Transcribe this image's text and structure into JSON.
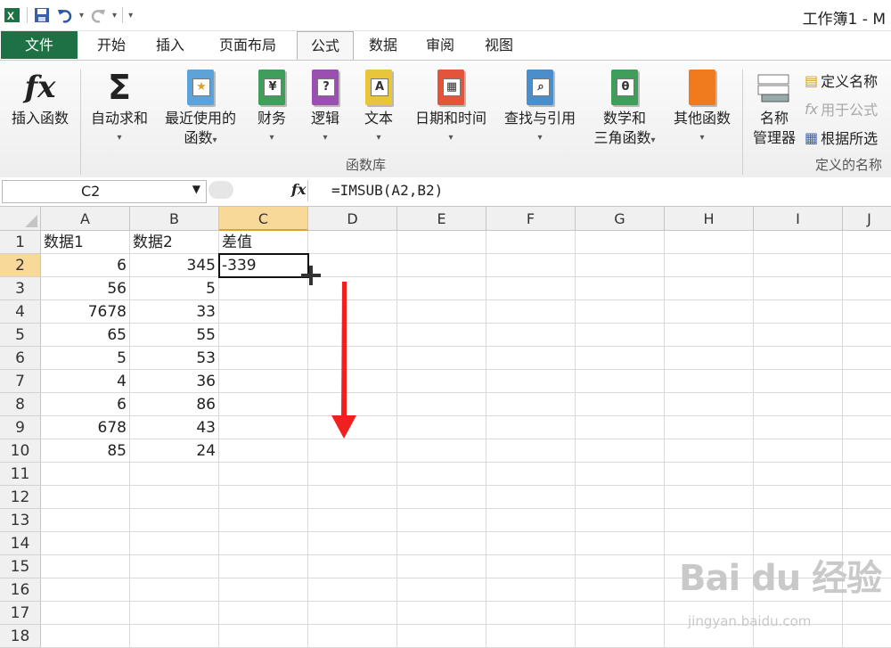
{
  "window": {
    "title": "工作簿1 - M"
  },
  "tabs": [
    {
      "label": "文件"
    },
    {
      "label": "开始"
    },
    {
      "label": "插入"
    },
    {
      "label": "页面布局"
    },
    {
      "label": "公式"
    },
    {
      "label": "数据"
    },
    {
      "label": "审阅"
    },
    {
      "label": "视图"
    }
  ],
  "ribbon": {
    "insert_function": "插入函数",
    "autosum": "自动求和",
    "recent_line1": "最近使用的",
    "recent_line2": "函数",
    "financial": "财务",
    "logical": "逻辑",
    "text": "文本",
    "datetime": "日期和时间",
    "lookup": "查找与引用",
    "math_line1": "数学和",
    "math_line2": "三角函数",
    "more": "其他函数",
    "group_library": "函数库",
    "name_mgr_line1": "名称",
    "name_mgr_line2": "管理器",
    "define_name": "定义名称",
    "use_in_formula": "用于公式",
    "create_from_sel": "根据所选",
    "group_names": "定义的名称",
    "fx_glyph": "fx",
    "sigma_glyph": "Σ",
    "caret": "▾"
  },
  "formula_bar": {
    "name_box": "C2",
    "fx_label": "fx",
    "formula": "=IMSUB(A2,B2)"
  },
  "columns": [
    "A",
    "B",
    "C",
    "D",
    "E",
    "F",
    "G",
    "H",
    "I",
    "J"
  ],
  "rows": [
    "1",
    "2",
    "3",
    "4",
    "5",
    "6",
    "7",
    "8",
    "9",
    "10",
    "11",
    "12",
    "13",
    "14",
    "15",
    "16",
    "17",
    "18"
  ],
  "cells": {
    "A1": "数据1",
    "B1": "数据2",
    "C1": "差值",
    "A2": "6",
    "B2": "345",
    "C2": "-339",
    "A3": "56",
    "B3": "5",
    "A4": "7678",
    "B4": "33",
    "A5": "65",
    "B5": "55",
    "A6": "5",
    "B6": "53",
    "A7": "4",
    "B7": "36",
    "A8": "6",
    "B8": "86",
    "A9": "678",
    "B9": "43",
    "A10": "85",
    "B10": "24"
  },
  "selection": {
    "cell": "C2",
    "column": "C",
    "row": "2"
  },
  "annotation": {
    "arrow_color": "#f02020"
  },
  "watermark": {
    "line1": "Bai du 经验",
    "line2": "jingyan.baidu.com"
  },
  "colors": {
    "file_tab": "#1e7145",
    "selected_header": "#f9d99a"
  }
}
